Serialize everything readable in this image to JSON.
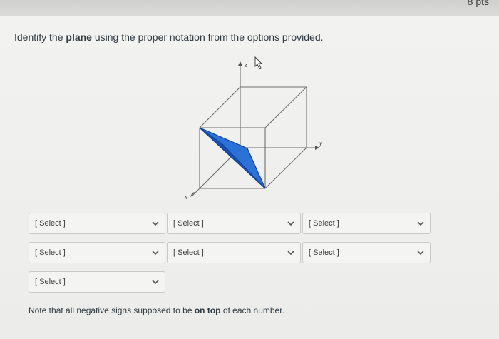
{
  "header": {
    "points": "8 pts"
  },
  "question": {
    "prompt_before": "Identify the ",
    "prompt_bold": "plane",
    "prompt_after": " using the proper notation from the options provided."
  },
  "figure": {
    "axis_z": "z",
    "axis_y": "y",
    "axis_x": "x",
    "plane_color": "#1f63c9"
  },
  "selects": [
    {
      "value": "[ Select ]"
    },
    {
      "value": "[ Select ]"
    },
    {
      "value": "[ Select ]"
    },
    {
      "value": "[ Select ]"
    },
    {
      "value": "[ Select ]"
    },
    {
      "value": "[ Select ]"
    },
    {
      "value": "[ Select ]"
    }
  ],
  "note": {
    "before": "Note that all negative signs supposed to be ",
    "bold1": "on top",
    "middle": " of each number."
  },
  "icons": {
    "dropdown": "chevron-down-icon",
    "cursor": "mouse-pointer-icon"
  }
}
